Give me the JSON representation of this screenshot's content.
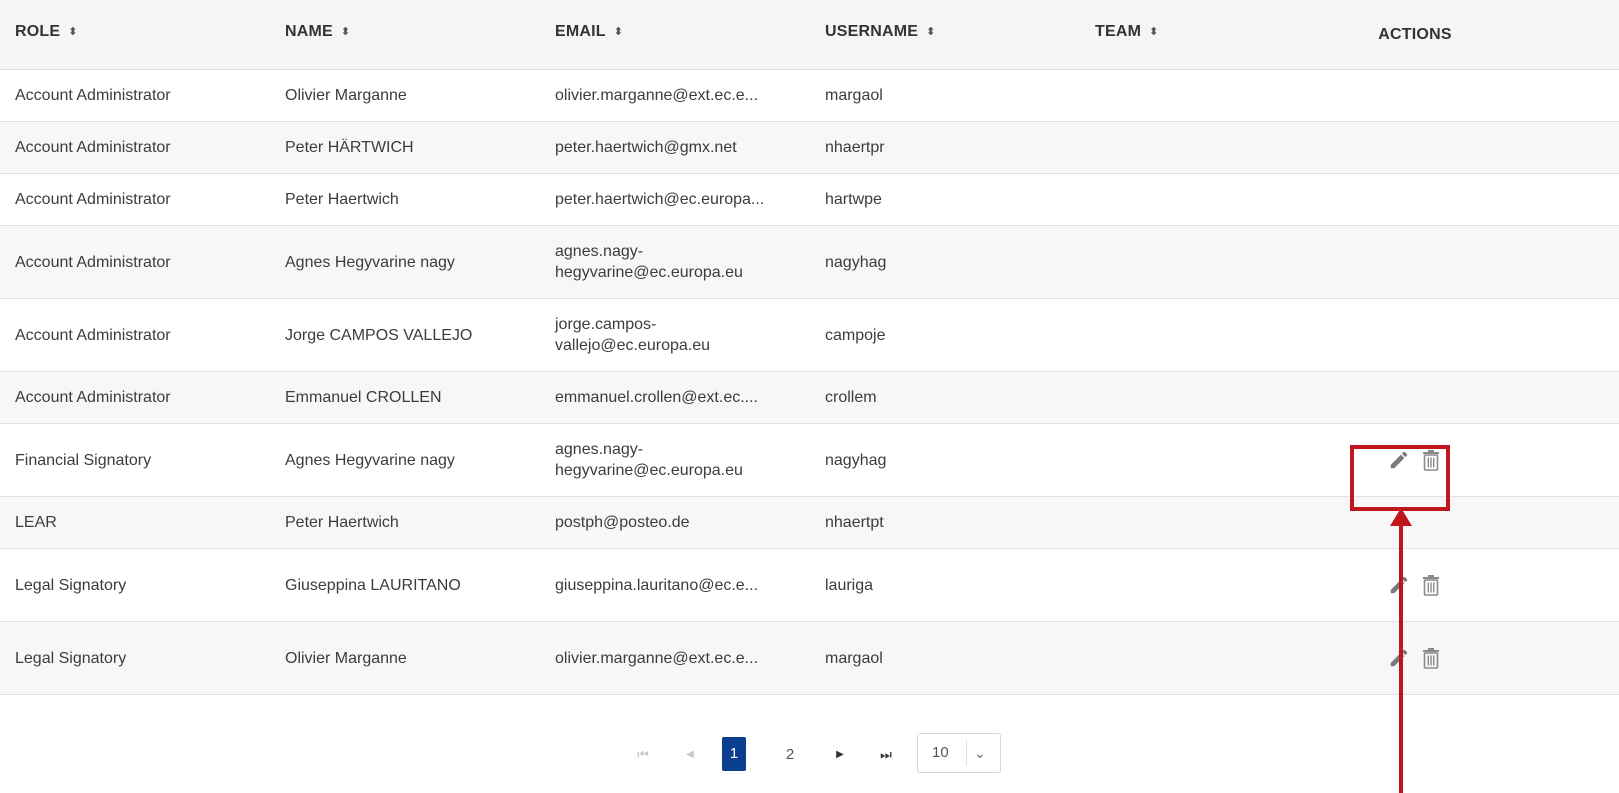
{
  "table": {
    "columns": [
      {
        "key": "role",
        "label": "ROLE",
        "sortable": true
      },
      {
        "key": "name",
        "label": "NAME",
        "sortable": true
      },
      {
        "key": "email",
        "label": "EMAIL",
        "sortable": true
      },
      {
        "key": "username",
        "label": "USERNAME",
        "sortable": true
      },
      {
        "key": "team",
        "label": "TEAM",
        "sortable": true
      },
      {
        "key": "actions",
        "label": "ACTIONS",
        "sortable": false
      }
    ],
    "sort_icon": "⬍",
    "rows": [
      {
        "role": "Account Administrator",
        "name": "Olivier Marganne",
        "email": "olivier.marganne@ext.ec.e...",
        "username": "margaol",
        "team": "",
        "actions": false
      },
      {
        "role": "Account Administrator",
        "name": "Peter HÄRTWICH",
        "email": "peter.haertwich@gmx.net",
        "username": "nhaertpr",
        "team": "",
        "actions": false
      },
      {
        "role": "Account Administrator",
        "name": "Peter Haertwich",
        "email": "peter.haertwich@ec.europa...",
        "username": "hartwpe",
        "team": "",
        "actions": false
      },
      {
        "role": "Account Administrator",
        "name": "Agnes Hegyvarine nagy",
        "email": "agnes.nagy-hegyvarine@ec.europa.eu",
        "username": "nagyhag",
        "team": "",
        "actions": false
      },
      {
        "role": "Account Administrator",
        "name": "Jorge CAMPOS VALLEJO",
        "email": "jorge.campos-vallejo@ec.europa.eu",
        "username": "campoje",
        "team": "",
        "actions": false
      },
      {
        "role": "Account Administrator",
        "name": "Emmanuel CROLLEN",
        "email": "emmanuel.crollen@ext.ec....",
        "username": "crollem",
        "team": "",
        "actions": false
      },
      {
        "role": "Financial Signatory",
        "name": "Agnes Hegyvarine nagy",
        "email": "agnes.nagy-hegyvarine@ec.europa.eu",
        "username": "nagyhag",
        "team": "",
        "actions": true
      },
      {
        "role": "LEAR",
        "name": "Peter Haertwich",
        "email": "postph@posteo.de",
        "username": "nhaertpt",
        "team": "",
        "actions": false
      },
      {
        "role": "Legal Signatory",
        "name": "Giuseppina LAURITANO",
        "email": "giuseppina.lauritano@ec.e...",
        "username": "lauriga",
        "team": "",
        "actions": true
      },
      {
        "role": "Legal Signatory",
        "name": "Olivier Marganne",
        "email": "olivier.marganne@ext.ec.e...",
        "username": "margaol",
        "team": "",
        "actions": true
      }
    ],
    "action_icons": {
      "edit": "pencil-icon",
      "delete": "trash-icon"
    }
  },
  "pagination": {
    "first_icon": "⏮",
    "prev_icon": "◀",
    "pages": [
      "1",
      "2"
    ],
    "current_page": "1",
    "next_icon": "▶",
    "last_icon": "⏭",
    "page_size": "10",
    "page_size_chevron": "⌄"
  },
  "annotation": {
    "color": "#c0151b"
  },
  "colors": {
    "header_bg": "#f5f5f5",
    "alt_row_bg": "#f7f7f7",
    "active_page": "#0b3e8e",
    "icon": "#7a7a7a"
  }
}
